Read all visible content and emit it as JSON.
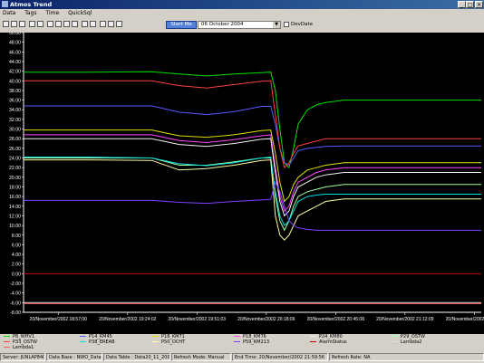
{
  "window": {
    "title": "Atmos Trend"
  },
  "menu": [
    "Data",
    "Tags",
    "Time",
    "QuickSql"
  ],
  "toolbar": {
    "start_label": "Start Me",
    "date_value": "06    October    2004",
    "devdate_label": "DevDate"
  },
  "chart_data": {
    "type": "line",
    "ylim": [
      -8,
      50
    ],
    "y_ticks": [
      "50.00",
      "48.00",
      "46.00",
      "44.00",
      "42.00",
      "40.00",
      "38.00",
      "36.00",
      "34.00",
      "32.00",
      "30.00",
      "28.00",
      "26.00",
      "24.00",
      "22.00",
      "20.00",
      "18.00",
      "16.00",
      "14.00",
      "12.00",
      "10.00",
      "8.00",
      "6.00",
      "4.00",
      "2.00",
      "0.00",
      "-2.00",
      "-4.00",
      "-6.00",
      "-8.00"
    ],
    "x_ticks": [
      "20/November/2002 18:57:00",
      "20/November/2002 19:24:02",
      "20/November/2002 19:51:03",
      "20/November/2002 20:18:06",
      "20/November/2002 20:45:08",
      "20/November/2002 21:12:09",
      "20/November/2002 21:39:10"
    ],
    "x": [
      0,
      7,
      14,
      17,
      20,
      23,
      26,
      27,
      27.5,
      28,
      28.5,
      29,
      29.5,
      30,
      31,
      32,
      33,
      35,
      40,
      45,
      50
    ],
    "series": [
      {
        "name": "P8_WHV1",
        "color": "#00e000",
        "values": [
          41.8,
          41.8,
          41.9,
          41.4,
          41.0,
          41.4,
          41.7,
          41.8,
          38,
          30,
          23,
          22,
          26,
          31,
          34,
          35,
          35.5,
          36,
          36,
          36,
          36
        ]
      },
      {
        "name": "P14_KM45",
        "color": "#5a5aff",
        "values": [
          34.8,
          34.8,
          34.8,
          33.5,
          33.0,
          33.6,
          34.7,
          34.7,
          31,
          26,
          23,
          22.5,
          24,
          25.5,
          26,
          26.2,
          26.4,
          26.5,
          26.5,
          26.5,
          26.5
        ]
      },
      {
        "name": "P18_KM71",
        "color": "#e0e000",
        "values": [
          29.8,
          29.8,
          29.8,
          28.6,
          28.3,
          28.8,
          29.7,
          29.8,
          25,
          19,
          15,
          16,
          18.5,
          20,
          21.5,
          22,
          22.5,
          23,
          23,
          23,
          23
        ]
      },
      {
        "name": "P18_KM76",
        "color": "#ff44ff",
        "values": [
          28.8,
          28.8,
          28.8,
          27.6,
          27.2,
          27.8,
          28.6,
          28.8,
          22,
          16,
          13,
          14,
          17,
          19,
          20,
          21,
          21.5,
          22,
          22,
          22,
          22
        ]
      },
      {
        "name": "P24_KM80",
        "color": "#f0f0f0",
        "values": [
          28.0,
          28.0,
          28.0,
          26.8,
          26.4,
          27.0,
          27.9,
          28.0,
          21,
          15,
          12,
          13,
          16,
          18,
          19,
          20,
          20.5,
          21,
          21,
          21,
          21
        ]
      },
      {
        "name": "P29_OSTW",
        "color": "#a0ffa0",
        "values": [
          24.0,
          24.0,
          24.0,
          22.5,
          22.5,
          23.2,
          24.0,
          24.0,
          16,
          11,
          9,
          11,
          14,
          16,
          17,
          17.5,
          18,
          18.5,
          18.5,
          18.5,
          18.5
        ]
      },
      {
        "name": "P33_OSTW",
        "color": "#ff4040",
        "values": [
          40.0,
          40.0,
          40.0,
          39.0,
          38.5,
          39.2,
          39.9,
          40.0,
          33,
          26,
          22,
          23,
          25,
          26.5,
          27,
          27.5,
          28,
          28,
          28,
          28,
          28
        ]
      },
      {
        "name": "P38_EREAB",
        "color": "#00e0e0",
        "values": [
          24.2,
          24.2,
          24.0,
          22.8,
          22.4,
          23.0,
          24.0,
          24.2,
          17,
          12,
          10,
          11,
          13,
          15,
          16,
          16.3,
          16.5,
          16.5,
          16.5,
          16.5,
          16.5
        ]
      },
      {
        "name": "P50_OCHT",
        "color": "#ffffa0",
        "values": [
          23.6,
          23.6,
          23.5,
          21.5,
          21.8,
          22.5,
          23.5,
          23.6,
          12,
          8,
          7,
          8,
          10,
          12,
          13,
          14,
          15,
          15.5,
          15.5,
          15.5,
          15.5
        ]
      },
      {
        "name": "P59_KM213",
        "color": "#8040ff",
        "values": [
          15.2,
          15.2,
          15.2,
          14.8,
          14.6,
          15.0,
          15.3,
          15.4,
          19,
          17,
          14,
          11,
          10,
          9.5,
          9.2,
          9,
          9,
          9,
          9,
          9,
          9
        ]
      },
      {
        "name": "AlarmStatus",
        "color": "#c00000",
        "values": [
          0,
          0,
          0,
          0,
          0,
          0,
          0,
          0,
          0,
          0,
          0,
          0,
          0,
          0,
          0,
          0,
          0,
          0,
          0,
          0,
          0
        ]
      },
      {
        "name": "Lambda2",
        "color": "#e0e0e0",
        "values": [
          -6,
          -6,
          -6,
          -6,
          -6,
          -6,
          -6,
          -6,
          -6,
          -6,
          -6,
          -6,
          -6,
          -6,
          -6,
          -6,
          -6,
          -6,
          -6,
          -6,
          -6
        ]
      },
      {
        "name": "Lambda1",
        "color": "#ff6060",
        "values": [
          -6.2,
          -6.2,
          -6.2,
          -6.2,
          -6.2,
          -6.2,
          -6.2,
          -6.2,
          -6.2,
          -6.2,
          -6.2,
          -6.2,
          -6.2,
          -6.2,
          -6.2,
          -6.2,
          -6.2,
          -6.2,
          -6.2,
          -6.2,
          -6.2
        ]
      }
    ]
  },
  "legend": [
    {
      "name": "P8_WHV1",
      "color": "#00e000"
    },
    {
      "name": "P14_KM45",
      "color": "#5a5aff"
    },
    {
      "name": "P18_KM71",
      "color": "#e0e000"
    },
    {
      "name": "P18_KM76",
      "color": "#ff44ff"
    },
    {
      "name": "P24_KM80",
      "color": "#f0f0f0"
    },
    {
      "name": "P29_OSTW",
      "color": "#a0ffa0"
    },
    {
      "name": "P33_OSTW",
      "color": "#ff4040"
    },
    {
      "name": "P38_EREAB",
      "color": "#00e0e0"
    },
    {
      "name": "P50_OCHT",
      "color": "#ffffa0"
    },
    {
      "name": "P59_KM213",
      "color": "#8040ff"
    },
    {
      "name": "AlarmStatus",
      "color": "#c00000"
    },
    {
      "name": "Lambda2",
      "color": "#e0e0e0"
    },
    {
      "name": "Lambda1",
      "color": "#ff6060"
    }
  ],
  "status": {
    "server": "Server: JUNLAP840",
    "database": "Data Base : NWO_Data",
    "table": "Data Table : Data20_11_2002",
    "refresh_mode": "Refresh Mode: Manual",
    "end_time": "End Time: 20/November/2002 21:59:56",
    "refresh_rate": "Refresh Rate: NA"
  }
}
